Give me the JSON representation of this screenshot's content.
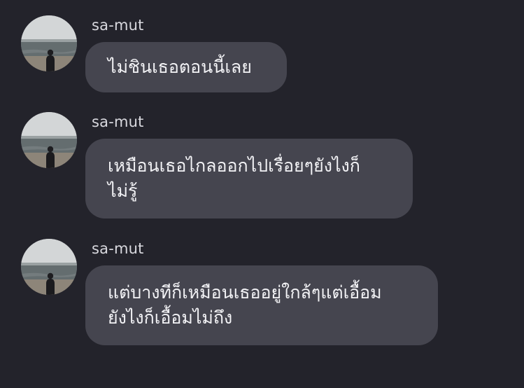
{
  "messages": [
    {
      "sender": "sa-mut",
      "avatar_icon": "profile-photo-person-at-sea-icon",
      "lines": [
        "ไม่ชินเธอตอนนี้เลย"
      ]
    },
    {
      "sender": "sa-mut",
      "avatar_icon": "profile-photo-person-at-sea-icon",
      "lines": [
        "เหมือนเธอไกลออกไปเรื่อยๆยังไงก็",
        "ไม่รู้"
      ]
    },
    {
      "sender": "sa-mut",
      "avatar_icon": "profile-photo-person-at-sea-icon",
      "lines": [
        "แต่บางทีก็เหมือนเธออยู่ใกล้ๆแต่เอื้อม",
        "ยังไงก็เอื้อมไม่ถึง"
      ]
    }
  ],
  "colors": {
    "background": "#23232b",
    "bubble": "#45454f",
    "text": "#f2f2f5",
    "sender": "#d8d8de"
  }
}
